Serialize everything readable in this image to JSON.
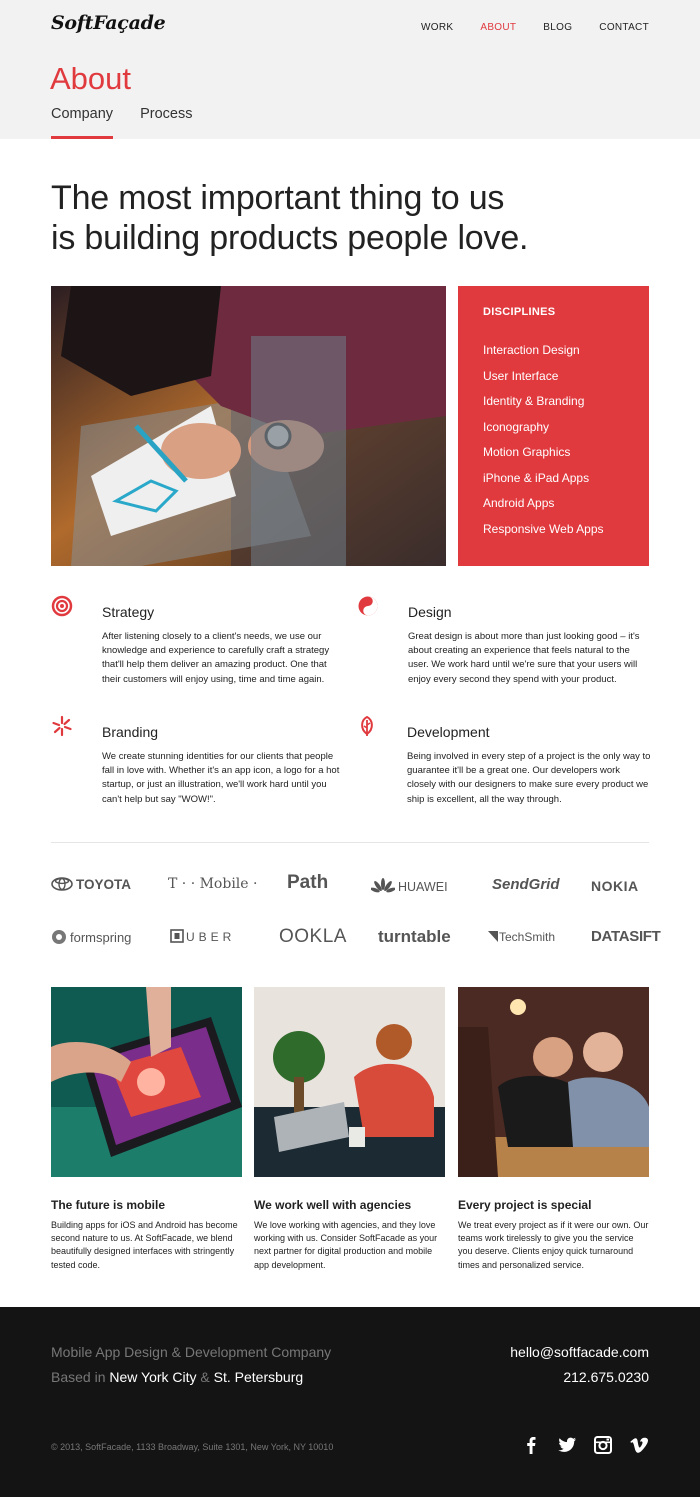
{
  "brand": {
    "logo": "SoftFaçade"
  },
  "nav": [
    {
      "label": "WORK",
      "active": false
    },
    {
      "label": "ABOUT",
      "active": true
    },
    {
      "label": "BLOG",
      "active": false
    },
    {
      "label": "CONTACT",
      "active": false
    }
  ],
  "page": {
    "title": "About",
    "tabs": [
      {
        "label": "Company",
        "active": true
      },
      {
        "label": "Process",
        "active": false
      }
    ],
    "headline_line1": "The most important thing to us",
    "headline_line2": "is building products people love."
  },
  "disciplines": {
    "heading": "DISCIPLINES",
    "items": [
      "Interaction Design",
      "User Interface",
      "Identity & Branding",
      "Iconography",
      "Motion Graphics",
      "iPhone & iPad Apps",
      "Android Apps",
      "Responsive Web Apps"
    ]
  },
  "services": [
    {
      "icon": "target-icon",
      "title": "Strategy",
      "text": "After listening closely to a client's needs, we use our knowledge and experience to carefully craft a strategy that'll help them deliver an amazing product. One that their customers will enjoy using, time and time again."
    },
    {
      "icon": "yin-yang-icon",
      "title": "Design",
      "text": "Great design is about more than just looking good – it's about creating an experience that feels natural to the user. We work hard until we're sure that your users will enjoy every second they spend with your product."
    },
    {
      "icon": "star-burst-icon",
      "title": "Branding",
      "text": "We create stunning identities for our clients that people fall in love with. Whether it's an app icon, a logo for a hot startup, or just an illustration, we'll work hard until you can't help but say \"WOW!\"."
    },
    {
      "icon": "leaf-icon",
      "title": "Development",
      "text": "Being involved in every step of a project is the only way to guarantee it'll be a great one. Our developers work closely with our designers to make sure every product we ship is excellent, all the way through."
    }
  ],
  "clients": [
    "TOYOTA",
    "T · · Mobile ·",
    "Path",
    "HUAWEI",
    "SendGrid",
    "NOKIA",
    "formspring",
    "UBER",
    "OOKLA",
    "turntable",
    "TechSmith",
    "DATASIFT"
  ],
  "features": [
    {
      "title": "The future is mobile",
      "text": "Building apps for iOS and Android has become second nature to us. At SoftFacade, we blend beautifully designed interfaces with stringently tested code."
    },
    {
      "title": "We work well with agencies",
      "text": "We love working with agencies, and they love working with us. Consider SoftFacade as your next partner for digital production and mobile app development."
    },
    {
      "title": "Every project is special",
      "text": "We treat every project as if it were our own. Our teams work tirelessly to give you the service you deserve. Clients enjoy quick turnaround times and personalized service."
    }
  ],
  "footer": {
    "tagline": "Mobile App Design & Development Company",
    "based_prefix": "Based in",
    "city1": "New York City",
    "amp": "&",
    "city2": "St. Petersburg",
    "email": "hello@softfacade.com",
    "phone": "212.675.0230",
    "copyright": "© 2013, SoftFacade, 1133 Broadway, Suite 1301, New York, NY 10010",
    "social": [
      "facebook-icon",
      "twitter-icon",
      "instagram-icon",
      "vimeo-icon"
    ]
  },
  "colors": {
    "accent": "#e03a3f",
    "footer_bg": "#141414",
    "header_bg": "#f2f2f2"
  }
}
